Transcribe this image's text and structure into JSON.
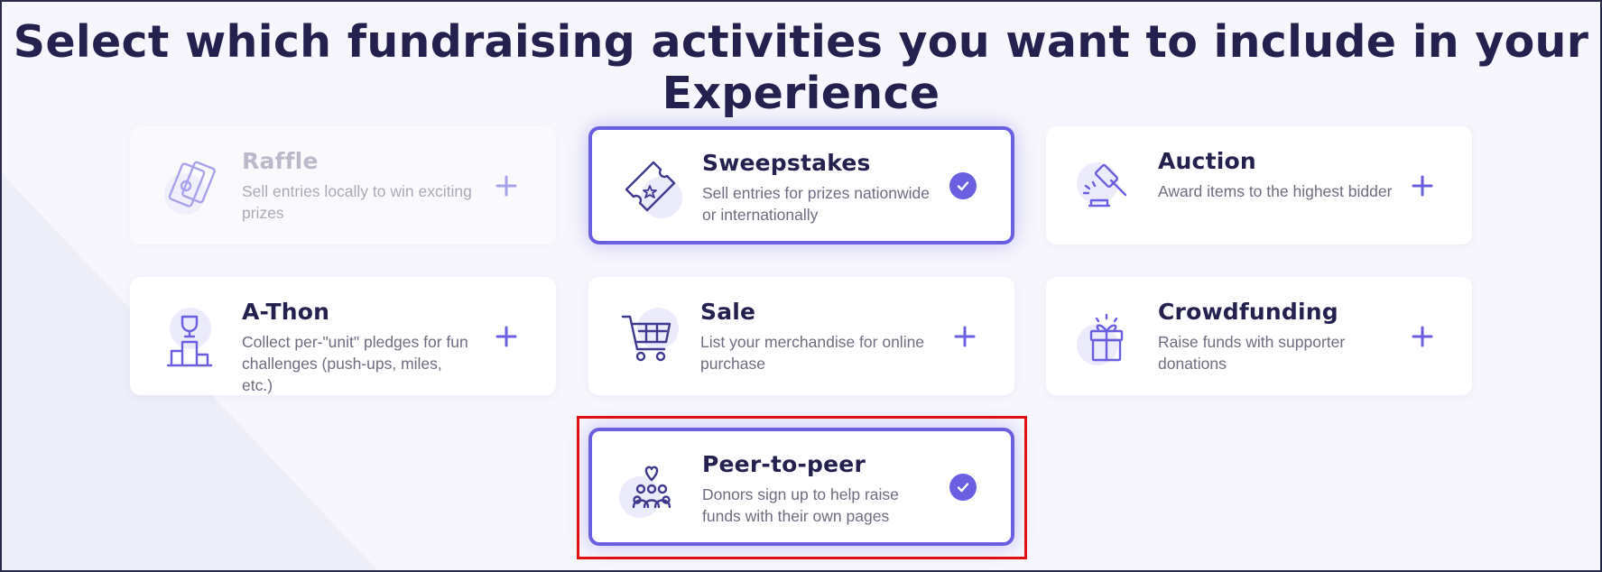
{
  "header": {
    "title": "Select which fundraising activities you want to include in your Experience"
  },
  "activities": [
    {
      "title": "Raffle",
      "description": "Sell entries locally to win exciting prizes",
      "icon": "raffle-tickets-icon",
      "state": "disabled"
    },
    {
      "title": "Sweepstakes",
      "description": "Sell entries for prizes nationwide or internationally",
      "icon": "sweepstakes-ticket-icon",
      "state": "selected"
    },
    {
      "title": "Auction",
      "description": "Award items to the highest bidder",
      "icon": "auction-gavel-icon",
      "state": "unselected"
    },
    {
      "title": "A-Thon",
      "description": "Collect per-\"unit\" pledges for fun challenges (push-ups, miles, etc.)",
      "icon": "trophy-podium-icon",
      "state": "unselected"
    },
    {
      "title": "Sale",
      "description": "List your merchandise for online purchase",
      "icon": "shopping-cart-icon",
      "state": "unselected"
    },
    {
      "title": "Crowdfunding",
      "description": "Raise funds with supporter donations",
      "icon": "gift-box-icon",
      "state": "unselected"
    },
    {
      "title": "Peer-to-peer",
      "description": "Donors sign up to help raise funds with their own pages",
      "icon": "people-heart-icon",
      "state": "selected"
    }
  ],
  "colors": {
    "accent": "#6a5fe0",
    "title": "#24214f",
    "highlight": "#e01010"
  }
}
